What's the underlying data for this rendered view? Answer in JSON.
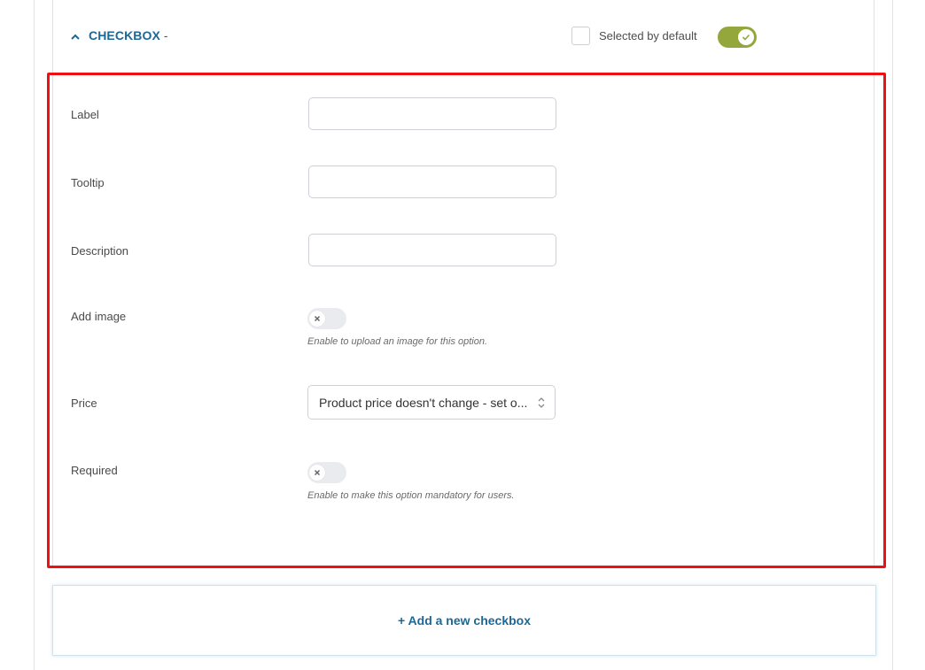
{
  "header": {
    "title": "CHECKBOX",
    "title_suffix": "-",
    "default_label": "Selected by default",
    "selected_by_default": false,
    "enabled": true
  },
  "fields": {
    "label": {
      "label": "Label",
      "value": ""
    },
    "tooltip": {
      "label": "Tooltip",
      "value": ""
    },
    "description": {
      "label": "Description",
      "value": ""
    },
    "add_image": {
      "label": "Add image",
      "enabled": false,
      "help": "Enable to upload an image for this option."
    },
    "price": {
      "label": "Price",
      "selected": "Product price doesn't change - set o..."
    },
    "required": {
      "label": "Required",
      "enabled": false,
      "help": "Enable to make this option mandatory for users."
    }
  },
  "footer": {
    "add_new_label": "+ Add a new checkbox"
  },
  "colors": {
    "accent": "#1d6796",
    "toggle_on": "#94a73d",
    "toggle_off": "#e9ebef",
    "highlight": "#ee1111"
  },
  "icons": {
    "collapse": "chevron-up-icon",
    "toggle_on": "check-icon",
    "toggle_off": "x-icon",
    "select": "updown-arrows-icon"
  }
}
